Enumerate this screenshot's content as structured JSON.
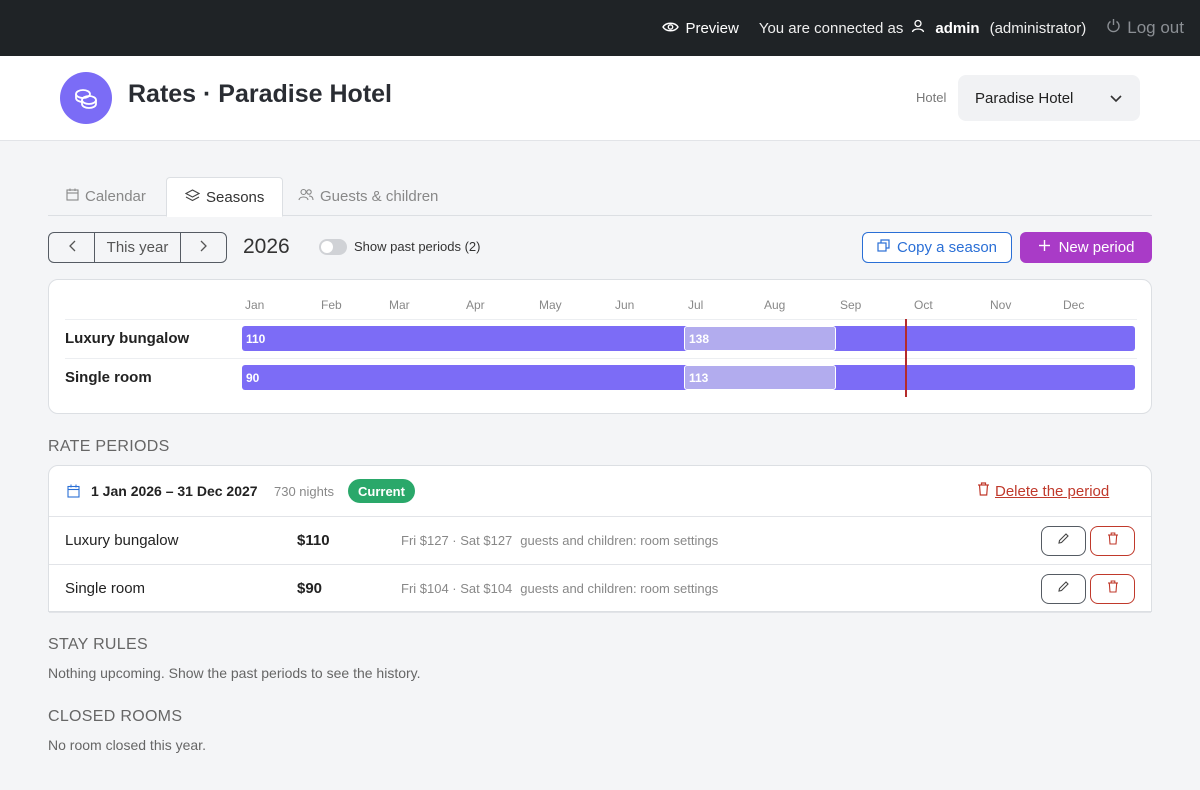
{
  "topbar": {
    "preview_label": "Preview",
    "connected_prefix": "You are connected as",
    "user_name": "admin",
    "user_role": "(administrator)",
    "logout_label": "Log out"
  },
  "header": {
    "title": "Rates · Paradise Hotel",
    "hotel_label": "Hotel",
    "hotel_value": "Paradise Hotel"
  },
  "tabs": [
    {
      "label": "Calendar",
      "icon": "calendar-icon"
    },
    {
      "label": "Seasons",
      "icon": "layers-icon",
      "active": true
    },
    {
      "label": "Guests & children",
      "icon": "users-icon"
    }
  ],
  "toolbar": {
    "this_year_label": "This year",
    "year": "2026",
    "toggle_label": "Show past periods (2)",
    "show_past_periods": false,
    "copy_label": "Copy a season",
    "new_period_label": "New period"
  },
  "gantt": {
    "months": [
      "Jan",
      "Feb",
      "Mar",
      "Apr",
      "May",
      "Jun",
      "Jul",
      "Aug",
      "Sep",
      "Oct",
      "Nov",
      "Dec"
    ],
    "rows": [
      {
        "label": "Luxury bungalow",
        "base_price": "110",
        "season_price": "138"
      },
      {
        "label": "Single room",
        "base_price": "90",
        "season_price": "113"
      }
    ]
  },
  "sections": {
    "rate_periods_title": "RATE PERIODS",
    "stay_rules_title": "STAY RULES",
    "stay_rules_text": "Nothing upcoming. Show the past periods to see the history.",
    "closed_rooms_title": "CLOSED ROOMS",
    "closed_rooms_text": "No room closed this year."
  },
  "period": {
    "range": "1 Jan 2026 – 31 Dec 2027",
    "nights": "730 nights",
    "badge": "Current",
    "delete_label": "Delete the period",
    "rows": [
      {
        "name": "Luxury bungalow",
        "price": "$110",
        "weekend": "Fri $127 · Sat $127",
        "guests": "guests and children: room settings"
      },
      {
        "name": "Single room",
        "price": "$90",
        "weekend": "Fri $104 · Sat $104",
        "guests": "guests and children: room settings"
      }
    ]
  },
  "colors": {
    "accent_purple": "#7c6cf6",
    "season_purple": "#b2acee",
    "new_button": "#a93bc7",
    "copy_blue": "#2a6fd6",
    "badge_green": "#2aa86a",
    "danger_red": "#c0392b"
  }
}
